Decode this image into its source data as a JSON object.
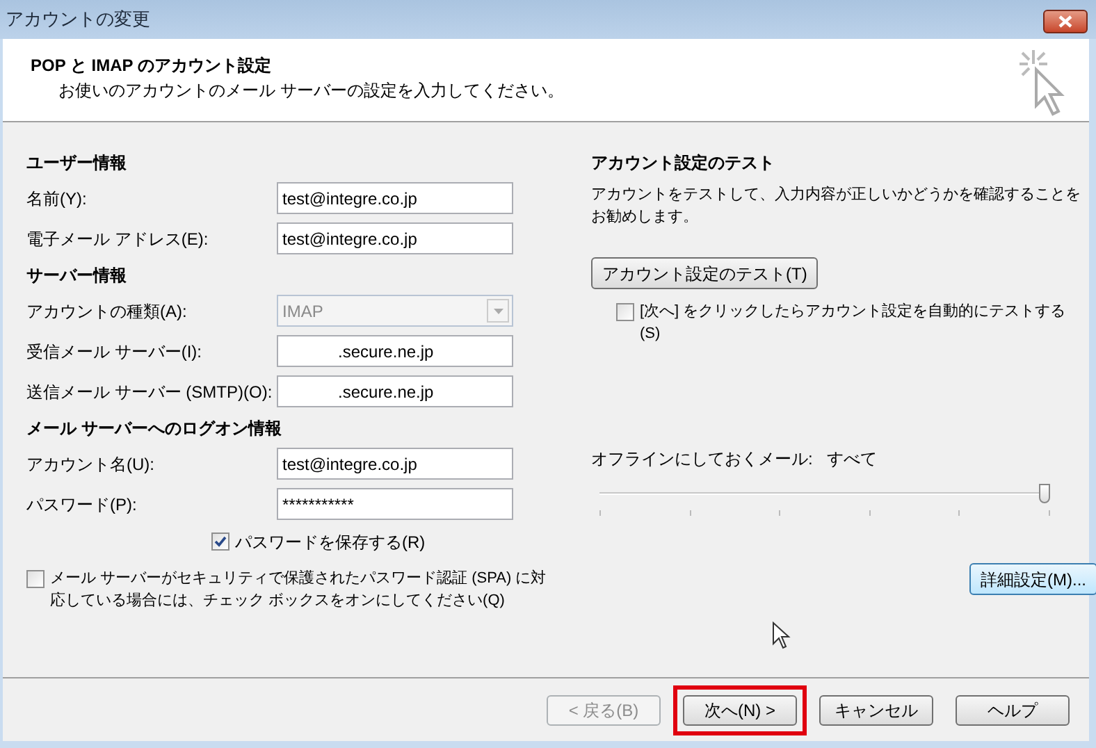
{
  "window": {
    "title": "アカウントの変更"
  },
  "header": {
    "title": "POP と IMAP のアカウント設定",
    "subtitle": "お使いのアカウントのメール サーバーの設定を入力してください。"
  },
  "left": [
    {
      "kind": "heading",
      "text": "ユーザー情報"
    },
    {
      "kind": "field",
      "label": "名前(Y):",
      "value": "test@integre.co.jp"
    },
    {
      "kind": "field",
      "label": "電子メール アドレス(E):",
      "value": "test@integre.co.jp"
    },
    {
      "kind": "heading",
      "text": "サーバー情報"
    },
    {
      "kind": "dropdown",
      "label": "アカウントの種類(A):",
      "value": "IMAP",
      "disabled": true
    },
    {
      "kind": "field",
      "label": "受信メール サーバー(I):",
      "value": "            .secure.ne.jp"
    },
    {
      "kind": "field",
      "label": "送信メール サーバー (SMTP)(O):",
      "value": "            .secure.ne.jp"
    },
    {
      "kind": "heading",
      "text": "メール サーバーへのログオン情報"
    },
    {
      "kind": "field",
      "label": "アカウント名(U):",
      "value": "test@integre.co.jp"
    },
    {
      "kind": "field",
      "label": "パスワード(P):",
      "value": "***********"
    },
    {
      "kind": "checkbox",
      "label": "パスワードを保存する(R)",
      "checked": true
    },
    {
      "kind": "wide_checkbox",
      "label": "メール サーバーがセキュリティで保護されたパスワード認証 (SPA) に対応している場合には、チェック ボックスをオンにしてください(Q)",
      "checked": false
    }
  ],
  "test": {
    "heading": "アカウント設定のテスト",
    "description": "アカウントをテストして、入力内容が正しいかどうかを確認することをお勧めします。",
    "button": "アカウント設定のテスト(T)",
    "auto_test": {
      "label": "[次へ] をクリックしたらアカウント設定を自動的にテストする (S)",
      "checked": false
    }
  },
  "offline": {
    "label": "オフラインにしておくメール:",
    "value": "すべて",
    "level": 1
  },
  "more_settings_button": "詳細設定(M)...",
  "footer_buttons": [
    {
      "label": "< 戻る(B)",
      "disabled": true,
      "highlighted": false
    },
    {
      "label": "次へ(N) >",
      "disabled": false,
      "highlighted": true
    },
    {
      "label": "キャンセル",
      "disabled": false,
      "highlighted": false
    },
    {
      "label": "ヘルプ",
      "disabled": false,
      "highlighted": false
    }
  ]
}
